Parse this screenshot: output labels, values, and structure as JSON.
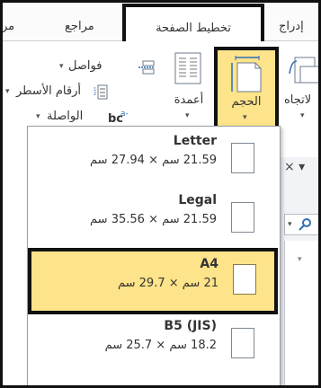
{
  "tabs": {
    "left_partial": "مر",
    "references": "مراجع",
    "page_layout": "تخطيط الصفحة",
    "insert_partial": "إدراج"
  },
  "ribbon": {
    "breaks": "فواصل",
    "line_numbers": "أرقام الأسطر",
    "hyphenation": "الواصلة",
    "columns": "أعمدة",
    "size": "الحجم",
    "orientation_partial": "لاتجاه",
    "dropdown_arrow": "▾"
  },
  "sizes": [
    {
      "name": "Letter",
      "dims": "21.59 سم × 27.94 سم"
    },
    {
      "name": "Legal",
      "dims": "21.59 سم × 35.56 سم"
    },
    {
      "name": "A4",
      "dims": "21 سم × 29.7 سم",
      "selected": true
    },
    {
      "name": "B5 (JIS)",
      "dims": "18.2 سم × 25.7 سم"
    }
  ],
  "background": {
    "close_glyph": "× ▾"
  },
  "colors": {
    "highlight": "#fde38a",
    "frame": "#111111"
  }
}
